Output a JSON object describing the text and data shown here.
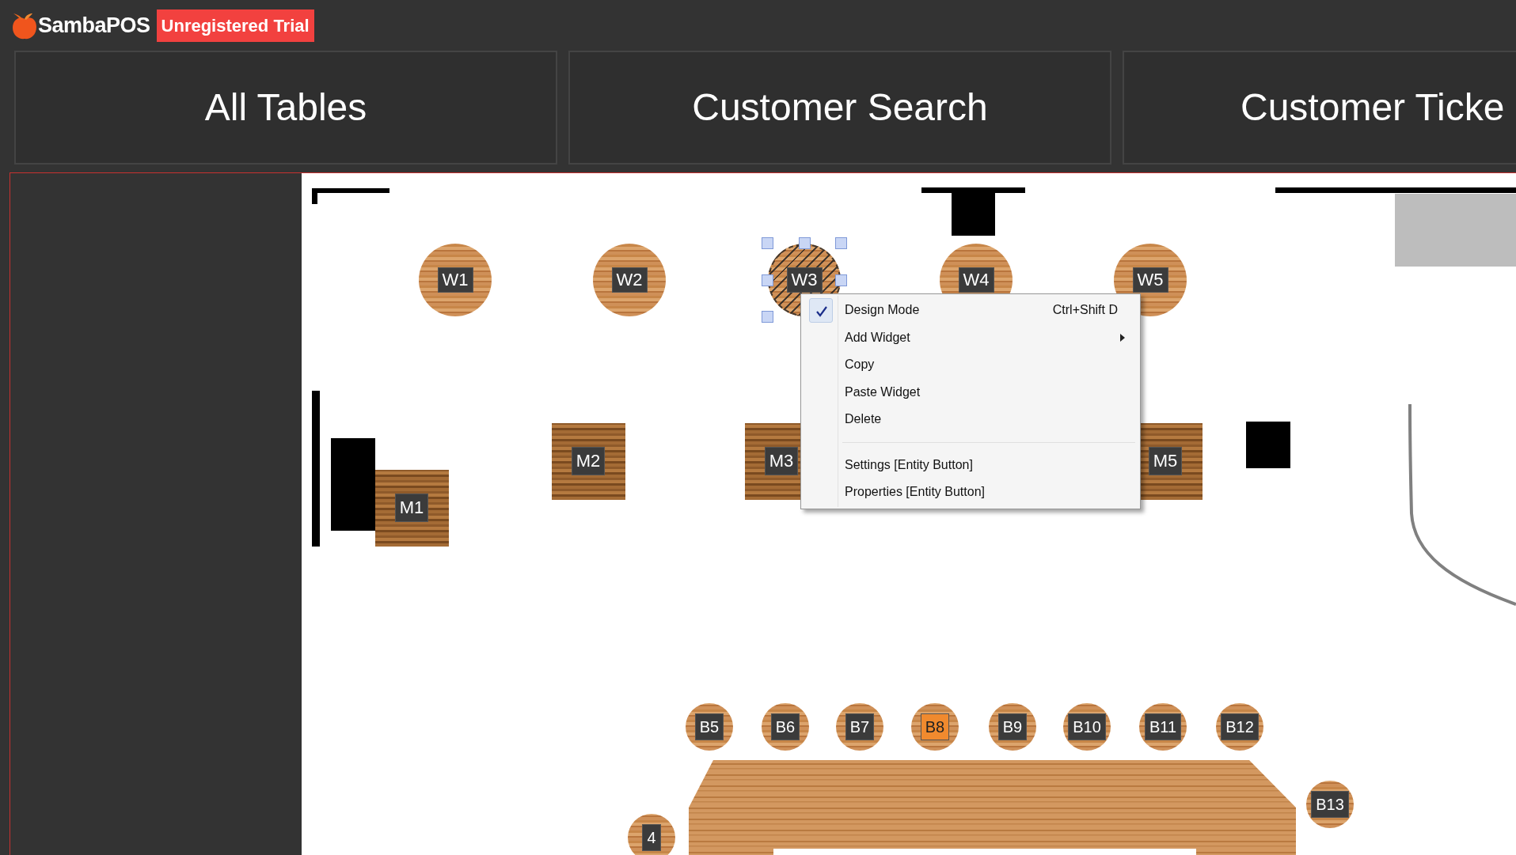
{
  "app": {
    "name": "SambaPOS",
    "badge": "Unregistered Trial"
  },
  "tabs": [
    {
      "label": "All Tables"
    },
    {
      "label": "Customer Search"
    },
    {
      "label": "Customer Ticke"
    }
  ],
  "floor_plan": {
    "tables": [
      {
        "label": "W1",
        "kind": "round",
        "selected": false,
        "highlighted": false
      },
      {
        "label": "W2",
        "kind": "round",
        "selected": false,
        "highlighted": false
      },
      {
        "label": "W3",
        "kind": "round",
        "selected": true,
        "highlighted": false
      },
      {
        "label": "W4",
        "kind": "round",
        "selected": false,
        "highlighted": false
      },
      {
        "label": "W5",
        "kind": "round",
        "selected": false,
        "highlighted": false
      },
      {
        "label": "M1",
        "kind": "square",
        "selected": false,
        "highlighted": false
      },
      {
        "label": "M2",
        "kind": "square",
        "selected": false,
        "highlighted": false
      },
      {
        "label": "M3",
        "kind": "square",
        "selected": false,
        "highlighted": false
      },
      {
        "label": "M5",
        "kind": "square",
        "selected": false,
        "highlighted": false
      },
      {
        "label": "B5",
        "kind": "stool",
        "selected": false,
        "highlighted": false
      },
      {
        "label": "B6",
        "kind": "stool",
        "selected": false,
        "highlighted": false
      },
      {
        "label": "B7",
        "kind": "stool",
        "selected": false,
        "highlighted": false
      },
      {
        "label": "B8",
        "kind": "stool",
        "selected": false,
        "highlighted": true
      },
      {
        "label": "B9",
        "kind": "stool",
        "selected": false,
        "highlighted": false
      },
      {
        "label": "B10",
        "kind": "stool",
        "selected": false,
        "highlighted": false
      },
      {
        "label": "B11",
        "kind": "stool",
        "selected": false,
        "highlighted": false
      },
      {
        "label": "B12",
        "kind": "stool",
        "selected": false,
        "highlighted": false
      },
      {
        "label": "B13",
        "kind": "stool",
        "selected": false,
        "highlighted": false
      },
      {
        "label": "4",
        "kind": "stool",
        "selected": false,
        "highlighted": false
      }
    ]
  },
  "context_menu": {
    "items": [
      {
        "kind": "item",
        "label": "Design Mode",
        "checked": true,
        "shortcut": "Ctrl+Shift D"
      },
      {
        "kind": "submenu",
        "label": "Add Widget",
        "checked": false
      },
      {
        "kind": "item",
        "label": "Copy",
        "checked": false
      },
      {
        "kind": "item",
        "label": "Paste Widget",
        "checked": false
      },
      {
        "kind": "item",
        "label": "Delete",
        "checked": false
      },
      {
        "kind": "separator"
      },
      {
        "kind": "item",
        "label": "Settings [Entity Button]",
        "checked": false
      },
      {
        "kind": "item",
        "label": "Properties [Entity Button]",
        "checked": false
      }
    ]
  }
}
